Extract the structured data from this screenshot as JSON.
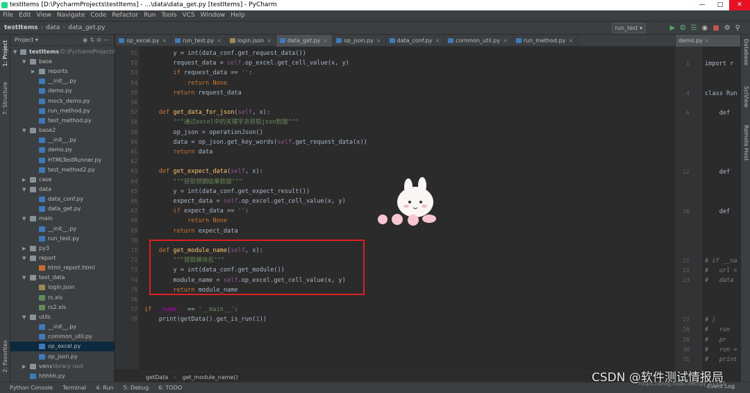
{
  "window": {
    "title": "testItems [D:\\PycharmProjects\\testItems] - ...\\data\\data_get.py [testItems] - PyCharm"
  },
  "menu": [
    "File",
    "Edit",
    "View",
    "Navigate",
    "Code",
    "Refactor",
    "Run",
    "Tools",
    "VCS",
    "Window",
    "Help"
  ],
  "breadcrumb": [
    "testItems",
    "data",
    "data_get.py"
  ],
  "run_config": "run_test ▾",
  "project_panel": {
    "title": "Project ▾",
    "root": "testItems",
    "root_path": "D:\\PycharmProjects\\testItems"
  },
  "tree": [
    {
      "label": "base",
      "type": "folder",
      "depth": 1,
      "open": true
    },
    {
      "label": "reports",
      "type": "folder",
      "depth": 2,
      "open": false
    },
    {
      "label": "__init__.py",
      "type": "py",
      "depth": 2
    },
    {
      "label": "demo.py",
      "type": "py",
      "depth": 2
    },
    {
      "label": "mock_demo.py",
      "type": "py",
      "depth": 2
    },
    {
      "label": "run_method.py",
      "type": "py",
      "depth": 2
    },
    {
      "label": "test_method.py",
      "type": "py",
      "depth": 2
    },
    {
      "label": "base2",
      "type": "folder",
      "depth": 1,
      "open": true
    },
    {
      "label": "__init__.py",
      "type": "py",
      "depth": 2
    },
    {
      "label": "demo.py",
      "type": "py",
      "depth": 2
    },
    {
      "label": "HTMLTestRunner.py",
      "type": "py",
      "depth": 2
    },
    {
      "label": "test_method2.py",
      "type": "py",
      "depth": 2
    },
    {
      "label": "case",
      "type": "folder",
      "depth": 1,
      "open": false
    },
    {
      "label": "data",
      "type": "folder",
      "depth": 1,
      "open": true
    },
    {
      "label": "data_conf.py",
      "type": "py",
      "depth": 2
    },
    {
      "label": "data_get.py",
      "type": "py",
      "depth": 2
    },
    {
      "label": "main",
      "type": "folder",
      "depth": 1,
      "open": true
    },
    {
      "label": "__init__.py",
      "type": "py",
      "depth": 2
    },
    {
      "label": "run_test.py",
      "type": "py",
      "depth": 2
    },
    {
      "label": "py3",
      "type": "folder",
      "depth": 1,
      "open": false
    },
    {
      "label": "report",
      "type": "folder",
      "depth": 1,
      "open": true
    },
    {
      "label": "html_report.html",
      "type": "html",
      "depth": 2
    },
    {
      "label": "test_data",
      "type": "folder",
      "depth": 1,
      "open": true
    },
    {
      "label": "login.json",
      "type": "json",
      "depth": 2
    },
    {
      "label": "rs.xls",
      "type": "xls",
      "depth": 2
    },
    {
      "label": "rs2.xls",
      "type": "xls",
      "depth": 2
    },
    {
      "label": "utils",
      "type": "folder",
      "depth": 1,
      "open": true
    },
    {
      "label": "__init__.py",
      "type": "py",
      "depth": 2
    },
    {
      "label": "common_util.py",
      "type": "py",
      "depth": 2
    },
    {
      "label": "op_excel.py",
      "type": "py",
      "depth": 2,
      "selected": true
    },
    {
      "label": "op_json.py",
      "type": "py",
      "depth": 2
    },
    {
      "label": "venv",
      "type": "folder",
      "depth": 1,
      "open": false,
      "extra": "library root"
    },
    {
      "label": "hhhhh.py",
      "type": "py",
      "depth": 1
    }
  ],
  "tabs": [
    {
      "label": "op_excel.py",
      "type": "py"
    },
    {
      "label": "run_test.py",
      "type": "py"
    },
    {
      "label": "login.json",
      "type": "json"
    },
    {
      "label": "data_get.py",
      "type": "py",
      "active": true
    },
    {
      "label": "op_json.py",
      "type": "py"
    },
    {
      "label": "data_conf.py",
      "type": "py"
    },
    {
      "label": "common_util.py",
      "type": "py"
    },
    {
      "label": "run_method.py",
      "type": "py"
    }
  ],
  "code_lines": [
    {
      "n": "51",
      "tokens": [
        [
          "        y = ",
          "p"
        ],
        [
          "int",
          "p"
        ],
        [
          "(data_conf.get_request_data())",
          "p"
        ]
      ]
    },
    {
      "n": "52",
      "tokens": [
        [
          "        request_data = ",
          "p"
        ],
        [
          "self",
          "sf"
        ],
        [
          ".op_excel.get_cell_value(x, y)",
          "p"
        ]
      ]
    },
    {
      "n": "53",
      "tokens": [
        [
          "        ",
          "p"
        ],
        [
          "if ",
          "kw"
        ],
        [
          "request_data == ",
          "p"
        ],
        [
          "''",
          "st"
        ],
        [
          ":",
          "p"
        ]
      ]
    },
    {
      "n": "54",
      "tokens": [
        [
          "            ",
          "p"
        ],
        [
          "return ",
          "kw"
        ],
        [
          "None",
          "kw"
        ]
      ]
    },
    {
      "n": "55",
      "tokens": [
        [
          "        ",
          "p"
        ],
        [
          "return ",
          "kw"
        ],
        [
          "request_data",
          "p"
        ]
      ]
    },
    {
      "n": "56",
      "tokens": []
    },
    {
      "n": "57",
      "tokens": [
        [
          "    ",
          "p"
        ],
        [
          "def ",
          "kw"
        ],
        [
          "get_data_for_json",
          "fn"
        ],
        [
          "(",
          "p"
        ],
        [
          "self",
          "sf"
        ],
        [
          ", x):",
          "p"
        ]
      ]
    },
    {
      "n": "58",
      "tokens": [
        [
          "        ",
          "p"
        ],
        [
          "\"\"\"通过excel中的关键字去获取json数据\"\"\"",
          "st"
        ]
      ]
    },
    {
      "n": "59",
      "tokens": [
        [
          "        op_json = operationJson()",
          "p"
        ]
      ]
    },
    {
      "n": "60",
      "tokens": [
        [
          "        data = op_json.get_key_words(",
          "p"
        ],
        [
          "self",
          "sf"
        ],
        [
          ".get_request_data(x))",
          "p"
        ]
      ]
    },
    {
      "n": "61",
      "tokens": [
        [
          "        ",
          "p"
        ],
        [
          "return ",
          "kw"
        ],
        [
          "data",
          "p"
        ]
      ]
    },
    {
      "n": "62",
      "tokens": []
    },
    {
      "n": "63",
      "tokens": [
        [
          "    ",
          "p"
        ],
        [
          "def ",
          "kw"
        ],
        [
          "get_expect_data",
          "fn"
        ],
        [
          "(",
          "p"
        ],
        [
          "self",
          "sf"
        ],
        [
          ", x):",
          "p"
        ]
      ]
    },
    {
      "n": "64",
      "tokens": [
        [
          "        ",
          "p"
        ],
        [
          "\"\"\"获取预期结果数据\"\"\"",
          "st"
        ]
      ]
    },
    {
      "n": "65",
      "tokens": [
        [
          "        y = ",
          "p"
        ],
        [
          "int",
          "p"
        ],
        [
          "(data_conf.get_expect_result())",
          "p"
        ]
      ]
    },
    {
      "n": "66",
      "tokens": [
        [
          "        expect_data = ",
          "p"
        ],
        [
          "self",
          "sf"
        ],
        [
          ".op_excel.get_cell_value(x, y)",
          "p"
        ]
      ]
    },
    {
      "n": "67",
      "tokens": [
        [
          "        ",
          "p"
        ],
        [
          "if ",
          "kw"
        ],
        [
          "expect_data == ",
          "p"
        ],
        [
          "''",
          "st"
        ],
        [
          ":",
          "p"
        ]
      ]
    },
    {
      "n": "68",
      "tokens": [
        [
          "            ",
          "p"
        ],
        [
          "return ",
          "kw"
        ],
        [
          "None",
          "kw"
        ]
      ]
    },
    {
      "n": "69",
      "tokens": [
        [
          "        ",
          "p"
        ],
        [
          "return ",
          "kw"
        ],
        [
          "expect_data",
          "p"
        ]
      ]
    },
    {
      "n": "70",
      "tokens": []
    },
    {
      "n": "71",
      "tokens": [
        [
          "    ",
          "p"
        ],
        [
          "def ",
          "kw"
        ],
        [
          "get_module_name",
          "fn"
        ],
        [
          "(",
          "p"
        ],
        [
          "self",
          "sf"
        ],
        [
          ", x):",
          "p"
        ]
      ]
    },
    {
      "n": "72",
      "tokens": [
        [
          "        ",
          "p"
        ],
        [
          "\"\"\"获取模块名\"\"\"",
          "st"
        ]
      ]
    },
    {
      "n": "73",
      "tokens": [
        [
          "        y = ",
          "p"
        ],
        [
          "int",
          "p"
        ],
        [
          "(data_conf.get_module())",
          "p"
        ]
      ]
    },
    {
      "n": "74",
      "tokens": [
        [
          "        module_name = ",
          "p"
        ],
        [
          "self",
          "sf"
        ],
        [
          ".op_excel.get_cell_value(x, y)",
          "p"
        ]
      ]
    },
    {
      "n": "75",
      "tokens": [
        [
          "        ",
          "p"
        ],
        [
          "return ",
          "kw"
        ],
        [
          "module_name",
          "p"
        ]
      ]
    },
    {
      "n": "76",
      "tokens": []
    },
    {
      "n": "77",
      "tokens": [
        [
          "if ",
          "kw"
        ],
        [
          "__name__",
          "dn"
        ],
        [
          " == ",
          "p"
        ],
        [
          "'__main__'",
          "st"
        ],
        [
          ":",
          "p"
        ]
      ]
    },
    {
      "n": "78",
      "tokens": [
        [
          "    ",
          "p"
        ],
        [
          "print",
          "p"
        ],
        [
          "(getData().get_is_run(",
          "p"
        ],
        [
          "1",
          "nm"
        ],
        [
          "))",
          "p"
        ]
      ]
    }
  ],
  "editor_breadcrumb": [
    "getData",
    "get_module_name()"
  ],
  "right_editor": {
    "tab": "demo.py",
    "lines": [
      {
        "n": "1",
        "t": "import r",
        "c": false
      },
      {
        "n": "4",
        "t": "class Run",
        "c": false
      },
      {
        "n": "6",
        "t": "    def",
        "c": false
      },
      {
        "n": "12",
        "t": "    def",
        "c": false
      },
      {
        "n": "16",
        "t": "    def",
        "c": false
      },
      {
        "n": "21",
        "t": "# if __na",
        "c": true
      },
      {
        "n": "22",
        "t": "#   url =",
        "c": true
      },
      {
        "n": "23",
        "t": "#   data",
        "c": true
      },
      {
        "n": "27",
        "t": "# }",
        "c": true
      },
      {
        "n": "28",
        "t": "#   run",
        "c": true
      },
      {
        "n": "29",
        "t": "#   pr",
        "c": true
      },
      {
        "n": "30",
        "t": "#   run =",
        "c": true
      },
      {
        "n": "31",
        "t": "#   print",
        "c": true
      }
    ]
  },
  "left_tools": [
    "1: Project",
    "7: Structure",
    "2: Favorites"
  ],
  "right_tools": [
    "Database",
    "SciView",
    "Remote Host"
  ],
  "status": [
    {
      "label": "Python Console",
      "ul": ""
    },
    {
      "label": "Terminal",
      "ul": ""
    },
    {
      "label": "4: Run",
      "ul": "4"
    },
    {
      "label": "5: Debug",
      "ul": "5"
    },
    {
      "label": "6: TODO",
      "ul": "6"
    }
  ],
  "event_log": "Event Log",
  "watermark": "CSDN @软件测试情报局",
  "watermark_small": "https://blog.csdn.net/qq_41555"
}
